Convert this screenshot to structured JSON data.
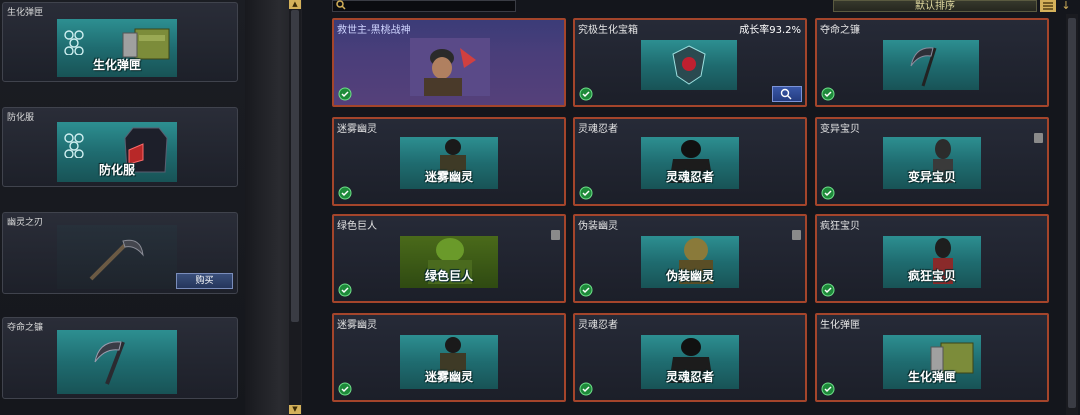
{
  "sidebar": {
    "items": [
      {
        "label": "生化弹匣",
        "banner_text": "生化弹匣",
        "icon": "ammo-crate-icon"
      },
      {
        "label": "防化服",
        "banner_text": "防化服",
        "icon": "armor-vest-icon"
      },
      {
        "label": "幽灵之刃",
        "banner_text": "",
        "icon": "scythe-icon",
        "buy_label": "购买"
      },
      {
        "label": "夺命之镰",
        "banner_text": "",
        "icon": "scythe-icon"
      }
    ]
  },
  "toolbar": {
    "search_value": "",
    "sort_label": "默认排序"
  },
  "grid": {
    "cards": [
      {
        "title": "救世主-黑桃战神",
        "banner_text": "",
        "featured": true
      },
      {
        "title": "究极生化宝箱",
        "rate": "成长率93.2%",
        "banner_text": ""
      },
      {
        "title": "夺命之镰",
        "banner_text": ""
      },
      {
        "title": "迷雾幽灵",
        "banner_text": "迷雾幽灵"
      },
      {
        "title": "灵魂忍者",
        "banner_text": "灵魂忍者"
      },
      {
        "title": "变异宝贝",
        "banner_text": "变异宝贝"
      },
      {
        "title": "绿色巨人",
        "banner_text": "绿色巨人"
      },
      {
        "title": "伪装幽灵",
        "banner_text": "伪装幽灵"
      },
      {
        "title": "疯狂宝贝",
        "banner_text": "疯狂宝贝"
      },
      {
        "title": "迷雾幽灵",
        "banner_text": "迷雾幽灵"
      },
      {
        "title": "灵魂忍者",
        "banner_text": "灵魂忍者"
      },
      {
        "title": "生化弹匣",
        "banner_text": "生化弹匣"
      }
    ]
  },
  "colors": {
    "accent_border": "#a4452b",
    "teal_banner": "#2d8f91",
    "scroll_arrow": "#d4b15a"
  }
}
